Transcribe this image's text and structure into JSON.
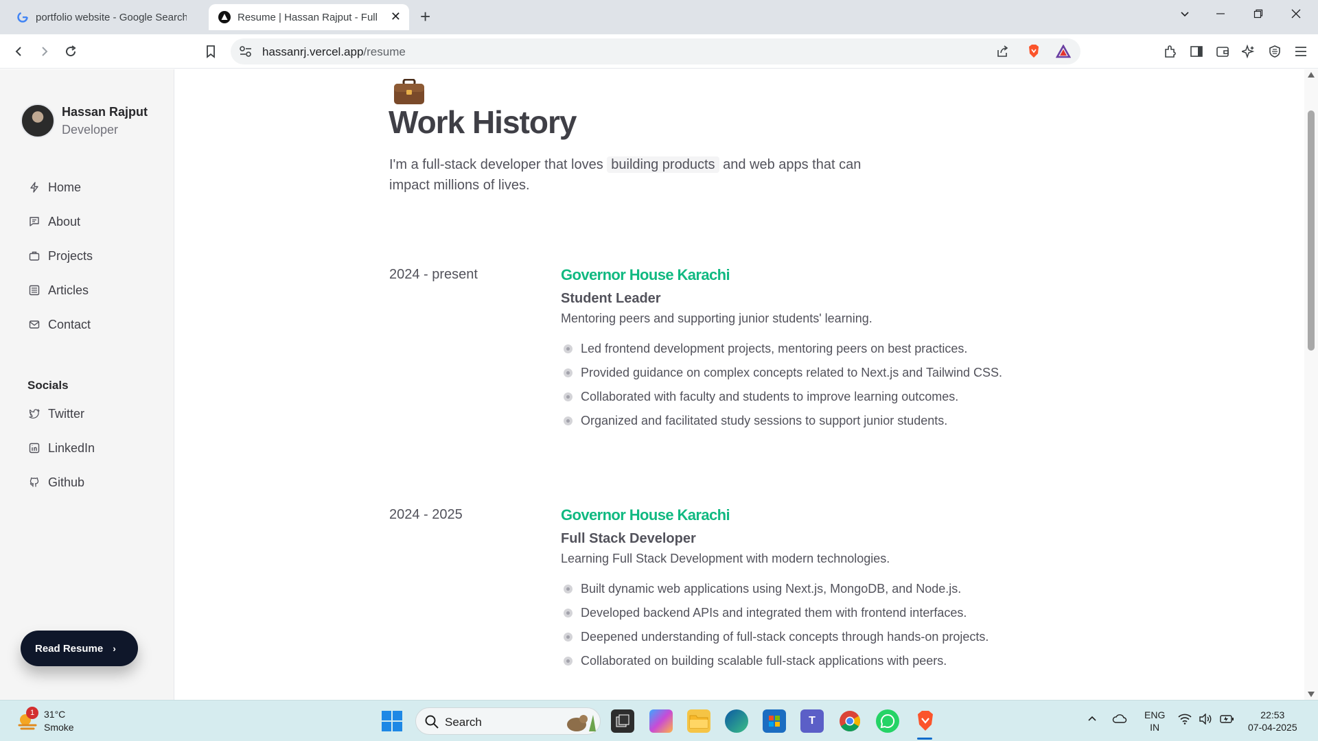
{
  "browser": {
    "tabs": [
      {
        "title": "portfolio website - Google Search",
        "active": false
      },
      {
        "title": "Resume | Hassan Rajput - Full S",
        "active": true
      }
    ],
    "url_host": "hassanrj.vercel.app",
    "url_path": "/resume"
  },
  "profile": {
    "name": "Hassan Rajput",
    "role": "Developer"
  },
  "nav": [
    {
      "label": "Home",
      "icon": "bolt-icon"
    },
    {
      "label": "About",
      "icon": "chat-icon"
    },
    {
      "label": "Projects",
      "icon": "briefcase-icon"
    },
    {
      "label": "Articles",
      "icon": "list-icon"
    },
    {
      "label": "Contact",
      "icon": "mail-icon"
    }
  ],
  "socials": {
    "heading": "Socials",
    "items": [
      {
        "label": "Twitter",
        "icon": "twitter-icon"
      },
      {
        "label": "LinkedIn",
        "icon": "linkedin-icon"
      },
      {
        "label": "Github",
        "icon": "github-icon"
      }
    ]
  },
  "read_resume": "Read Resume",
  "page": {
    "title": "Work History",
    "intro_before": "I'm a full-stack developer that loves ",
    "intro_highlight": "building products",
    "intro_after": " and web apps that can impact millions of lives."
  },
  "jobs": [
    {
      "period": "2024 - present",
      "company": "Governor House Karachi",
      "role": "Student Leader",
      "description": "Mentoring peers and supporting junior students' learning.",
      "bullets": [
        "Led frontend development projects, mentoring peers on best practices.",
        "Provided guidance on complex concepts related to Next.js and Tailwind CSS.",
        "Collaborated with faculty and students to improve learning outcomes.",
        "Organized and facilitated study sessions to support junior students."
      ]
    },
    {
      "period": "2024 - 2025",
      "company": "Governor House Karachi",
      "role": "Full Stack Developer",
      "description": "Learning Full Stack Development with modern technologies.",
      "bullets": [
        "Built dynamic web applications using Next.js, MongoDB, and Node.js.",
        "Developed backend APIs and integrated them with frontend interfaces.",
        "Deepened understanding of full-stack concepts through hands-on projects.",
        "Collaborated on building scalable full-stack applications with peers."
      ]
    }
  ],
  "taskbar": {
    "weather_temp": "31°C",
    "weather_cond": "Smoke",
    "weather_badge": "1",
    "search": "Search",
    "lang_top": "ENG",
    "lang_bottom": "IN",
    "time": "22:53",
    "date": "07-04-2025"
  },
  "colors": {
    "accent": "#10b981",
    "button": "#0f172a"
  }
}
